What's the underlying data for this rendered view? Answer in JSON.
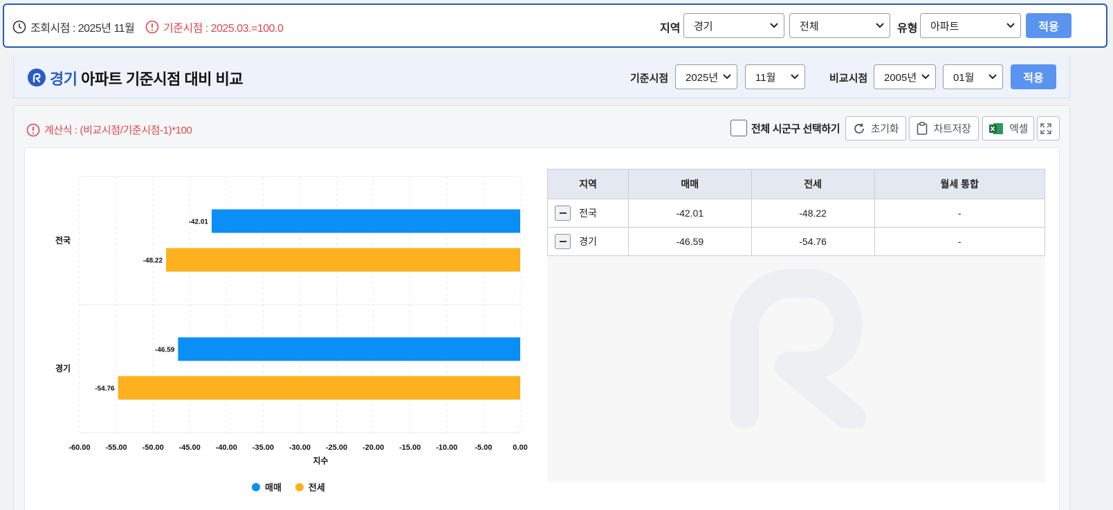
{
  "topbar": {
    "lookup_label": "조회시점 : 2025년 11월",
    "base_label": "기준시점 : 2025.03.=100.0",
    "region_label": "지역",
    "region_value": "경기",
    "subregion_value": "전체",
    "type_label": "유형",
    "type_value": "아파트",
    "apply_label": "적용"
  },
  "titlebar": {
    "region": "경기",
    "title": "아파트 기준시점 대비 비교",
    "base_label": "기준시점",
    "base_year": "2025년",
    "base_month": "11월",
    "compare_label": "비교시점",
    "compare_year": "2005년",
    "compare_month": "01월",
    "apply_label": "적용"
  },
  "toolbar": {
    "formula": "계산식 : (비교시점/기준시점-1)*100",
    "select_all_label": "전체 시군구 선택하기",
    "reset_label": "초기화",
    "save_chart_label": "차트저장",
    "excel_label": "엑셀"
  },
  "colors": {
    "sale": "#0b8ef6",
    "jeonse": "#fdb11e",
    "accent": "#2a5bc4",
    "warning": "#e0464c"
  },
  "chart_data": {
    "type": "bar",
    "orientation": "horizontal",
    "categories": [
      "전국",
      "경기"
    ],
    "series": [
      {
        "name": "매매",
        "values": [
          -42.01,
          -46.59
        ]
      },
      {
        "name": "전세",
        "values": [
          -48.22,
          -54.76
        ]
      }
    ],
    "xlabel": "지수",
    "xlim": [
      -60,
      0
    ],
    "xticks": [
      "-60.00",
      "-55.00",
      "-50.00",
      "-45.00",
      "-40.00",
      "-35.00",
      "-30.00",
      "-25.00",
      "-20.00",
      "-15.00",
      "-10.00",
      "-5.00",
      "0.00"
    ],
    "value_labels": [
      [
        "-42.01",
        "-46.59"
      ],
      [
        "-48.22",
        "-54.76"
      ]
    ],
    "grid": true,
    "legend": "bottom"
  },
  "table": {
    "headers": [
      "지역",
      "매매",
      "전세",
      "월세 통합"
    ],
    "rows": [
      [
        "전국",
        "-42.01",
        "-48.22",
        "-"
      ],
      [
        "경기",
        "-46.59",
        "-54.76",
        "-"
      ]
    ]
  }
}
